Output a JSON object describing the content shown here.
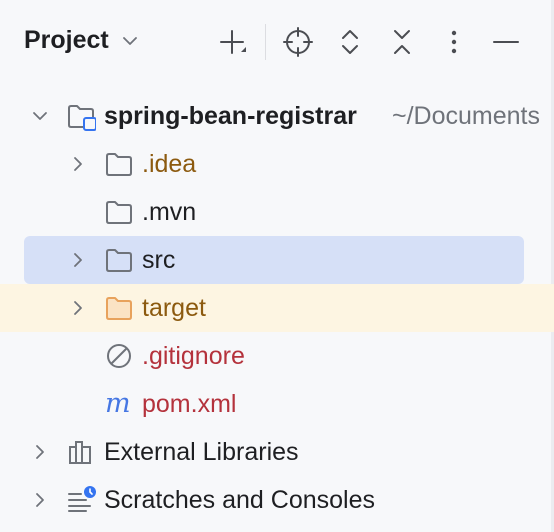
{
  "header": {
    "title": "Project"
  },
  "tree": {
    "root": {
      "name": "spring-bean-registrar",
      "path": "~/Documents"
    },
    "items": [
      {
        "label": ".idea"
      },
      {
        "label": ".mvn"
      },
      {
        "label": "src"
      },
      {
        "label": "target"
      },
      {
        "label": ".gitignore"
      },
      {
        "label": "pom.xml"
      }
    ],
    "external_libraries": "External Libraries",
    "scratches": "Scratches and Consoles"
  },
  "colors": {
    "accent": "#3574f0",
    "selection": "#d6e0f7",
    "excluded_bg": "#fdf5e2",
    "ignored_text": "#8c5a0f",
    "untracked_text": "#b4323c",
    "maven_icon": "#4677e3"
  }
}
